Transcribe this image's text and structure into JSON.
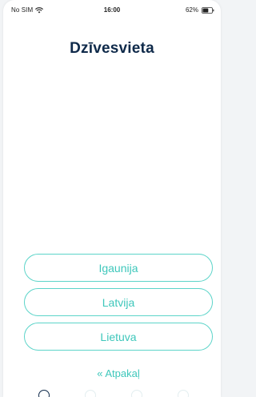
{
  "status_bar": {
    "carrier": "No SIM",
    "time": "16:00",
    "battery": "62%",
    "battery_level": 0.62
  },
  "title": "Dzīvesvieta",
  "options": [
    {
      "label": "Igaunija"
    },
    {
      "label": "Latvija"
    },
    {
      "label": "Lietuva"
    }
  ],
  "back_label": "« Atpakaļ",
  "pager": {
    "count": 4,
    "active": 0
  },
  "colors": {
    "accent": "#3ec7bb",
    "title": "#0f2a4a"
  }
}
